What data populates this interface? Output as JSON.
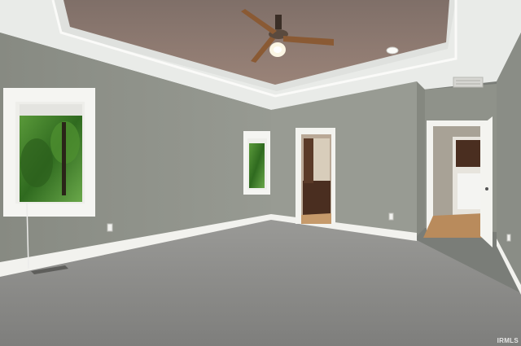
{
  "scene": {
    "watermark": "IRMLS",
    "colors": {
      "wall_left": "#8a8c85",
      "wall_back": "#979a92",
      "wall_right": "#8e918a",
      "ceiling": "#eceeeb",
      "tray_ceiling": "#8a7a72",
      "carpet": "#8c8c8a",
      "trim": "#f4f4f0",
      "foliage": "#3f7a2a",
      "wood_cabinet": "#4a2e20",
      "hall_floor": "#b98b5c"
    },
    "icons": [
      "ceiling-fan-icon",
      "air-vent-icon",
      "outlet-icon"
    ]
  }
}
